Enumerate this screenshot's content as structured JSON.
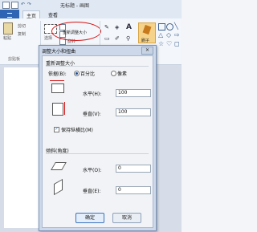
{
  "window": {
    "title": "无标题 - 画图"
  },
  "tabs": [
    "主页",
    "查看"
  ],
  "ribbon": {
    "paste": "粘贴",
    "cut": "剪切",
    "copy": "复制",
    "clipboard_group": "剪贴板",
    "select": "选择",
    "resize": "重新调整大小",
    "rotate": "旋转",
    "brush": "刷子",
    "text_tool": "A"
  },
  "dialog": {
    "title": "调整大小和扭曲",
    "close": "✕",
    "resize_section": "重新调整大小",
    "basis_label": "依据(B):",
    "option_percent": "百分比",
    "option_pixels": "像素",
    "horizontal_label": "水平(H):",
    "horizontal_value": "100",
    "vertical_label": "垂直(V):",
    "vertical_value": "100",
    "keep_ratio": "保持纵横比(M)",
    "skew_section": "倾斜(角度)",
    "skew_h_label": "水平(O):",
    "skew_h_value": "0",
    "skew_v_label": "垂直(E):",
    "skew_v_value": "0",
    "ok": "确定",
    "cancel": "取消"
  },
  "colors": {
    "accent": "#2d64b3",
    "highlight_circle": "#d51414"
  }
}
